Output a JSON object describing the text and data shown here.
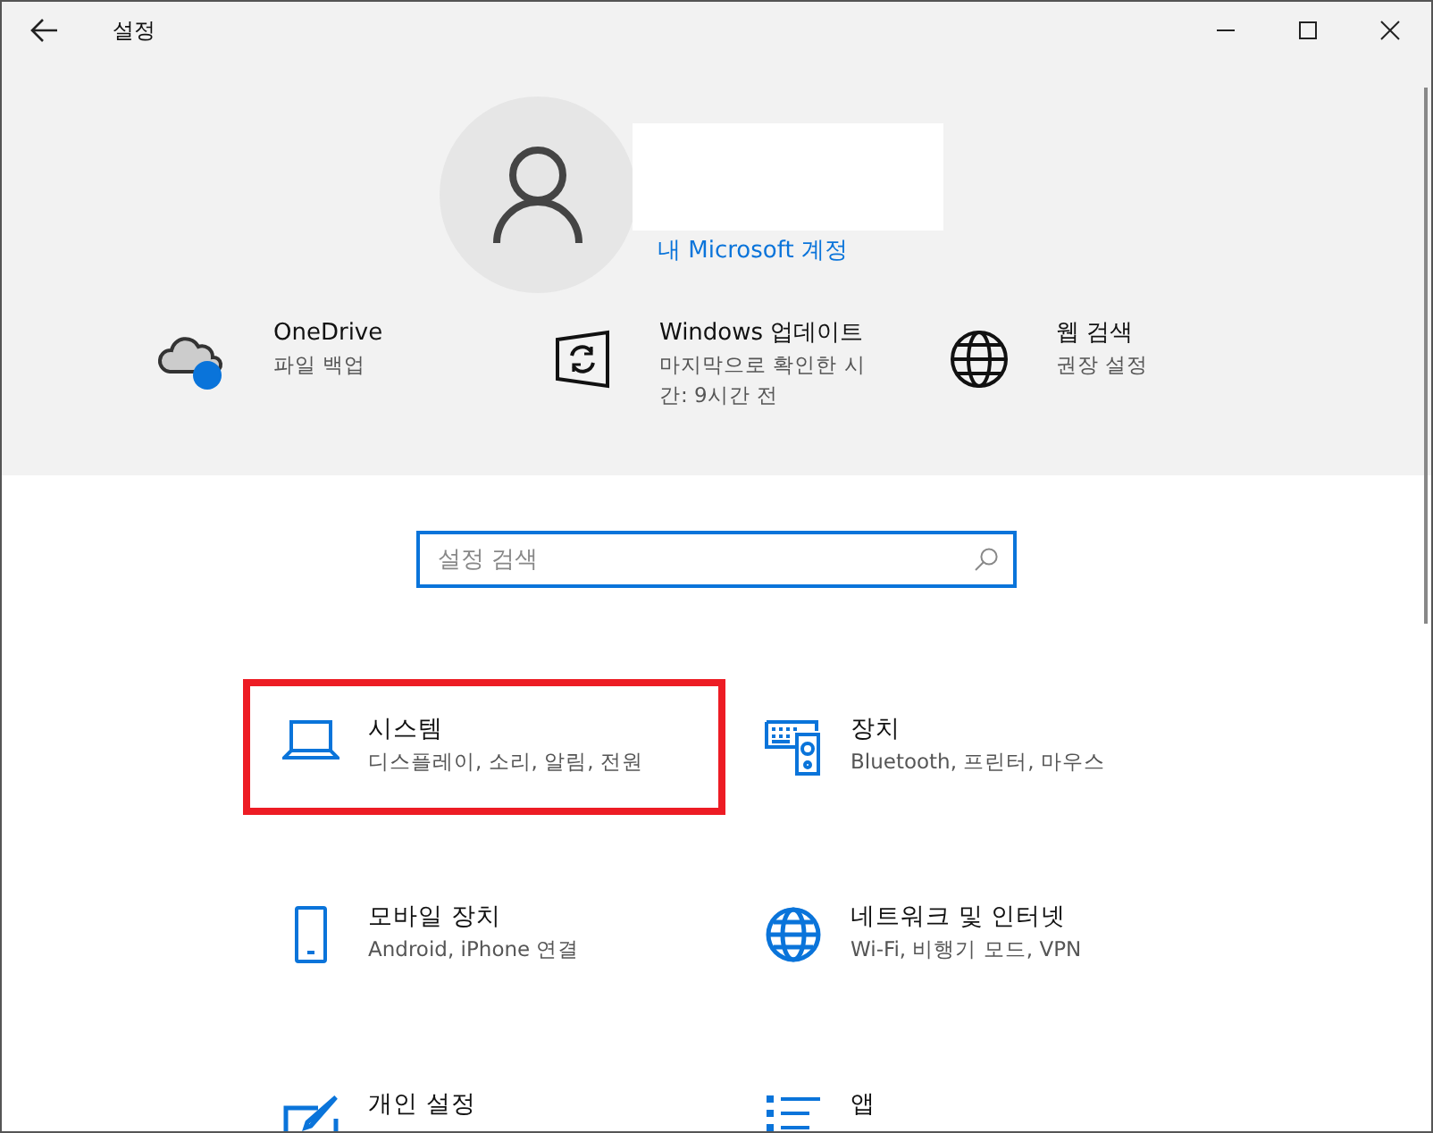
{
  "window": {
    "title": "설정"
  },
  "account": {
    "link": "내 Microsoft 계정"
  },
  "quick_links": [
    {
      "kind": "onedrive",
      "title": "OneDrive",
      "subtitle": "파일 백업"
    },
    {
      "kind": "update",
      "title": "Windows 업데이트",
      "subtitle": "마지막으로 확인한 시간: 9시간 전"
    },
    {
      "kind": "web",
      "title": "웹 검색",
      "subtitle": "권장 설정"
    }
  ],
  "search": {
    "placeholder": "설정 검색"
  },
  "categories": [
    {
      "kind": "system",
      "title": "시스템",
      "subtitle": "디스플레이, 소리, 알림, 전원",
      "selected": true
    },
    {
      "kind": "devices",
      "title": "장치",
      "subtitle": "Bluetooth, 프린터, 마우스",
      "selected": false
    },
    {
      "kind": "phone",
      "title": "모바일 장치",
      "subtitle": "Android, iPhone 연결",
      "selected": false
    },
    {
      "kind": "network",
      "title": "네트워크 및 인터넷",
      "subtitle": "Wi-Fi, 비행기 모드, VPN",
      "selected": false
    },
    {
      "kind": "personal",
      "title": "개인 설정",
      "selected": false
    },
    {
      "kind": "apps",
      "title": "앱",
      "selected": false
    }
  ]
}
